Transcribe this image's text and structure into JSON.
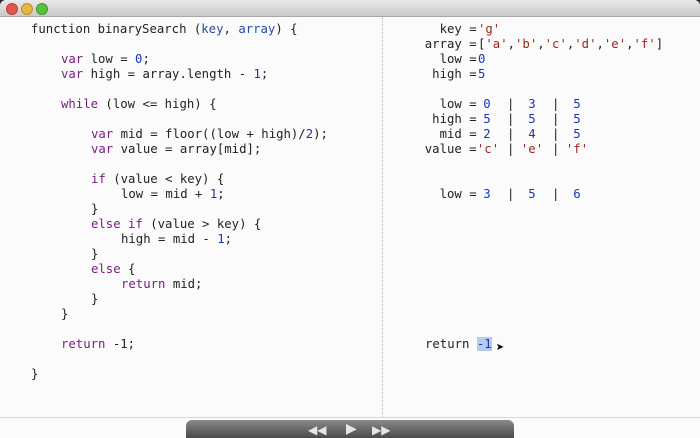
{
  "code": {
    "l1": {
      "a": "function binarySearch (",
      "b": "key",
      "c": ", ",
      "d": "array",
      "e": ") {"
    },
    "l2": {
      "a": "var",
      "b": " low = ",
      "c": "0",
      "d": ";"
    },
    "l3": {
      "a": "var",
      "b": " high = array.length - ",
      "c": "1",
      "d": ";"
    },
    "l4": {
      "a": "while",
      "b": " (low <= high) {"
    },
    "l5": {
      "a": "var",
      "b": " mid = floor((low + high)/",
      "c": "2",
      "d": ");"
    },
    "l6": {
      "a": "var",
      "b": " value = array[mid];"
    },
    "l7": {
      "a": "if",
      "b": " (value < key) {"
    },
    "l8": {
      "a": "low = mid + ",
      "b": "1",
      "c": ";"
    },
    "l9": "}",
    "l10": {
      "a": "else if",
      "b": " (value > key) {"
    },
    "l11": {
      "a": "high = mid - ",
      "b": "1",
      "c": ";"
    },
    "l12": "}",
    "l13": {
      "a": "else",
      "b": " {"
    },
    "l14": {
      "a": "return",
      "b": " mid;"
    },
    "l15": "}",
    "l16": "}",
    "l17": {
      "a": "return",
      "b": " -1;"
    },
    "l18": "}"
  },
  "trace": {
    "key": {
      "label": "key = ",
      "value": "'g'"
    },
    "array": {
      "label": "array = ",
      "open": "[",
      "items": [
        "'a'",
        "'b'",
        "'c'",
        "'d'",
        "'e'",
        "'f'"
      ],
      "sep": ",",
      "close": "]"
    },
    "low": {
      "label": "low = ",
      "value": "0"
    },
    "high": {
      "label": "high = ",
      "value": "5"
    },
    "loop": {
      "low": {
        "label": "low = ",
        "v": [
          "0",
          "3",
          "5"
        ]
      },
      "high": {
        "label": "high = ",
        "v": [
          "5",
          "5",
          "5"
        ]
      },
      "mid": {
        "label": "mid = ",
        "v": [
          "2",
          "4",
          "5"
        ]
      },
      "value": {
        "label": "value = ",
        "v": [
          "'c'",
          "'e'",
          "'f'"
        ]
      }
    },
    "after_low": {
      "label": "low = ",
      "v": [
        "3",
        "5",
        "6"
      ]
    },
    "sep": "|",
    "result": {
      "label": "return ",
      "value": "-1"
    }
  },
  "controls": {
    "rewind_icon": "rewind-icon",
    "play_icon": "play-icon",
    "forward_icon": "fast-forward-icon"
  }
}
